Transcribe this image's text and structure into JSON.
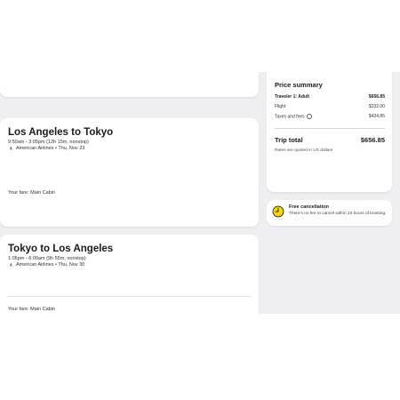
{
  "outbound": {
    "title": "Los Angeles to Tokyo",
    "time": "9:50am - 3:05pm (12h 15m, nonstop)",
    "airline": "American Airlines • Thu, Nov 23",
    "fare": "Your fare: Main Cabin"
  },
  "return": {
    "title": "Tokyo to Los Angeles",
    "time": "1:05pm - 6:00am (9h 55m, nonstop)",
    "airline": "American Airlines • Thu, Nov 30",
    "fare": "Your fare: Main Cabin"
  },
  "price_summary": {
    "title": "Price summary",
    "traveler_label": "Traveler 1: Adult",
    "traveler_value": "$656.85",
    "flight_label": "Flight",
    "flight_value": "$232.00",
    "taxes_label": "Taxes and fees",
    "taxes_value": "$424.85",
    "total_label": "Trip total",
    "total_value": "$656.85",
    "note": "Rates are quoted in US dollars"
  },
  "cancellation": {
    "title": "Free cancellation",
    "text": "There's no fee to cancel within 24 hours of booking.",
    "icon": "clock-icon",
    "accent": "#f5d90a"
  }
}
